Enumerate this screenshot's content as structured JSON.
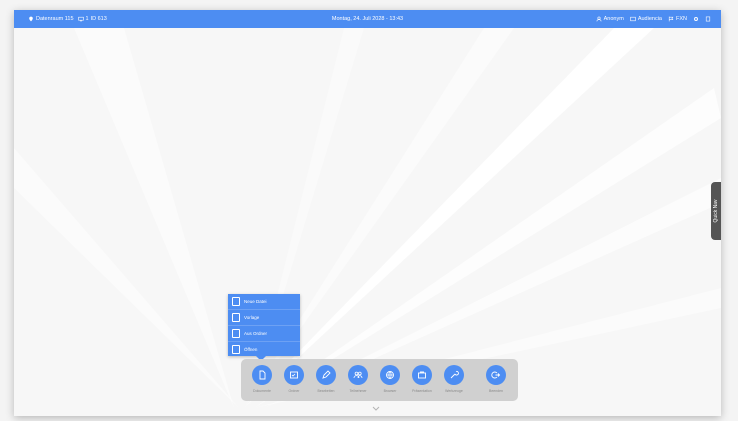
{
  "topbar": {
    "room": "Datenraum 115",
    "display": "1",
    "display_id": "ID 613",
    "datetime": "Montag, 24. Juli 2028 - 13:43",
    "anonymous": "Anonym",
    "audience": "Audiencia",
    "flag_label": "FXN",
    "room_icon": "pin-icon",
    "display_icon": "monitor-icon",
    "user_icon": "user-icon",
    "audience_icon": "audience-icon",
    "flag_icon": "flag-icon",
    "settings_icon": "gear-icon",
    "more_icon": "menu-icon"
  },
  "side_tab": {
    "label": "Quick Nav"
  },
  "popup_menu": {
    "items": [
      {
        "label": "Neue Datei",
        "icon": "new-file-icon"
      },
      {
        "label": "Vorlage",
        "icon": "template-icon"
      },
      {
        "label": "Aus Ordner",
        "icon": "folder-icon"
      },
      {
        "label": "Öffnen",
        "icon": "open-file-icon"
      }
    ]
  },
  "dock": {
    "items": [
      {
        "label": "Dokumente",
        "icon": "document-icon"
      },
      {
        "label": "Ordner",
        "icon": "folder-icon"
      },
      {
        "label": "Bearbeiten",
        "icon": "pencil-icon"
      },
      {
        "label": "Teilnehmer",
        "icon": "people-icon"
      },
      {
        "label": "Browser",
        "icon": "globe-icon"
      },
      {
        "label": "Präsentation",
        "icon": "briefcase-icon"
      },
      {
        "label": "Werkzeuge",
        "icon": "wrench-icon"
      },
      {
        "label": "Beenden",
        "icon": "exit-icon"
      }
    ]
  },
  "colors": {
    "accent": "#4d8df2",
    "dock_bg": "#d0d0d0",
    "dark_tab": "#555555"
  }
}
